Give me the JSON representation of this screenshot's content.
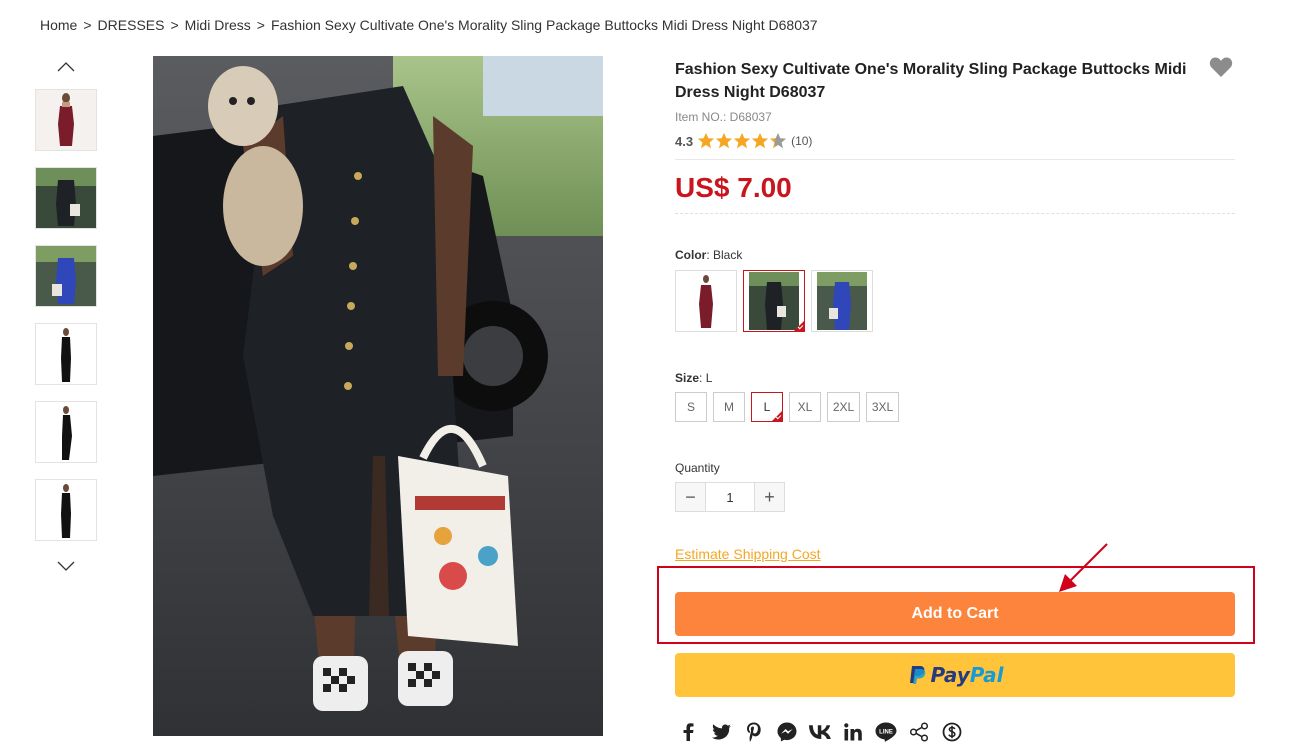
{
  "breadcrumb": {
    "items": [
      "Home",
      "DRESSES",
      "Midi Dress",
      "Fashion Sexy Cultivate One's Morality Sling Package Buttocks Midi Dress Night D68037"
    ],
    "separator": ">"
  },
  "thumbnails": {
    "up_icon": "chevron-up-icon",
    "down_icon": "chevron-down-icon",
    "items": [
      "burgundy-dress-thumb",
      "black-dress-thumb",
      "blue-dress-thumb",
      "black-dress-front-thumb",
      "black-dress-side-thumb",
      "black-dress-back-thumb"
    ]
  },
  "product": {
    "title": "Fashion Sexy Cultivate One's Morality Sling Package Buttocks Midi Dress Night D68037",
    "item_no": "Item NO.: D68037",
    "rating": "4.3",
    "rating_value": 4.3,
    "rating_max": 5,
    "rating_count": "(10)",
    "price": "US$ 7.00",
    "price_color": "#c9151e"
  },
  "color": {
    "label": "Color",
    "selected": "Black",
    "options": [
      "Burgundy",
      "Black",
      "Blue"
    ]
  },
  "size": {
    "label": "Size",
    "selected": "L",
    "options": [
      "S",
      "M",
      "L",
      "XL",
      "2XL",
      "3XL"
    ]
  },
  "quantity": {
    "label": "Quantity",
    "value": "1",
    "minus": "−",
    "plus": "+"
  },
  "shipping": {
    "link": "Estimate Shipping Cost"
  },
  "buttons": {
    "add_to_cart": "Add to Cart",
    "add_to_cart_color": "#fd843d",
    "paypal_left": "Pay",
    "paypal_right": "Pal",
    "paypal_color": "#ffc439"
  },
  "annotation": {
    "box_color": "#d0021b"
  },
  "share": [
    "facebook-icon",
    "twitter-icon",
    "pinterest-icon",
    "messenger-icon",
    "vk-icon",
    "linkedin-icon",
    "line-icon",
    "share-icon",
    "dollar-icon"
  ]
}
